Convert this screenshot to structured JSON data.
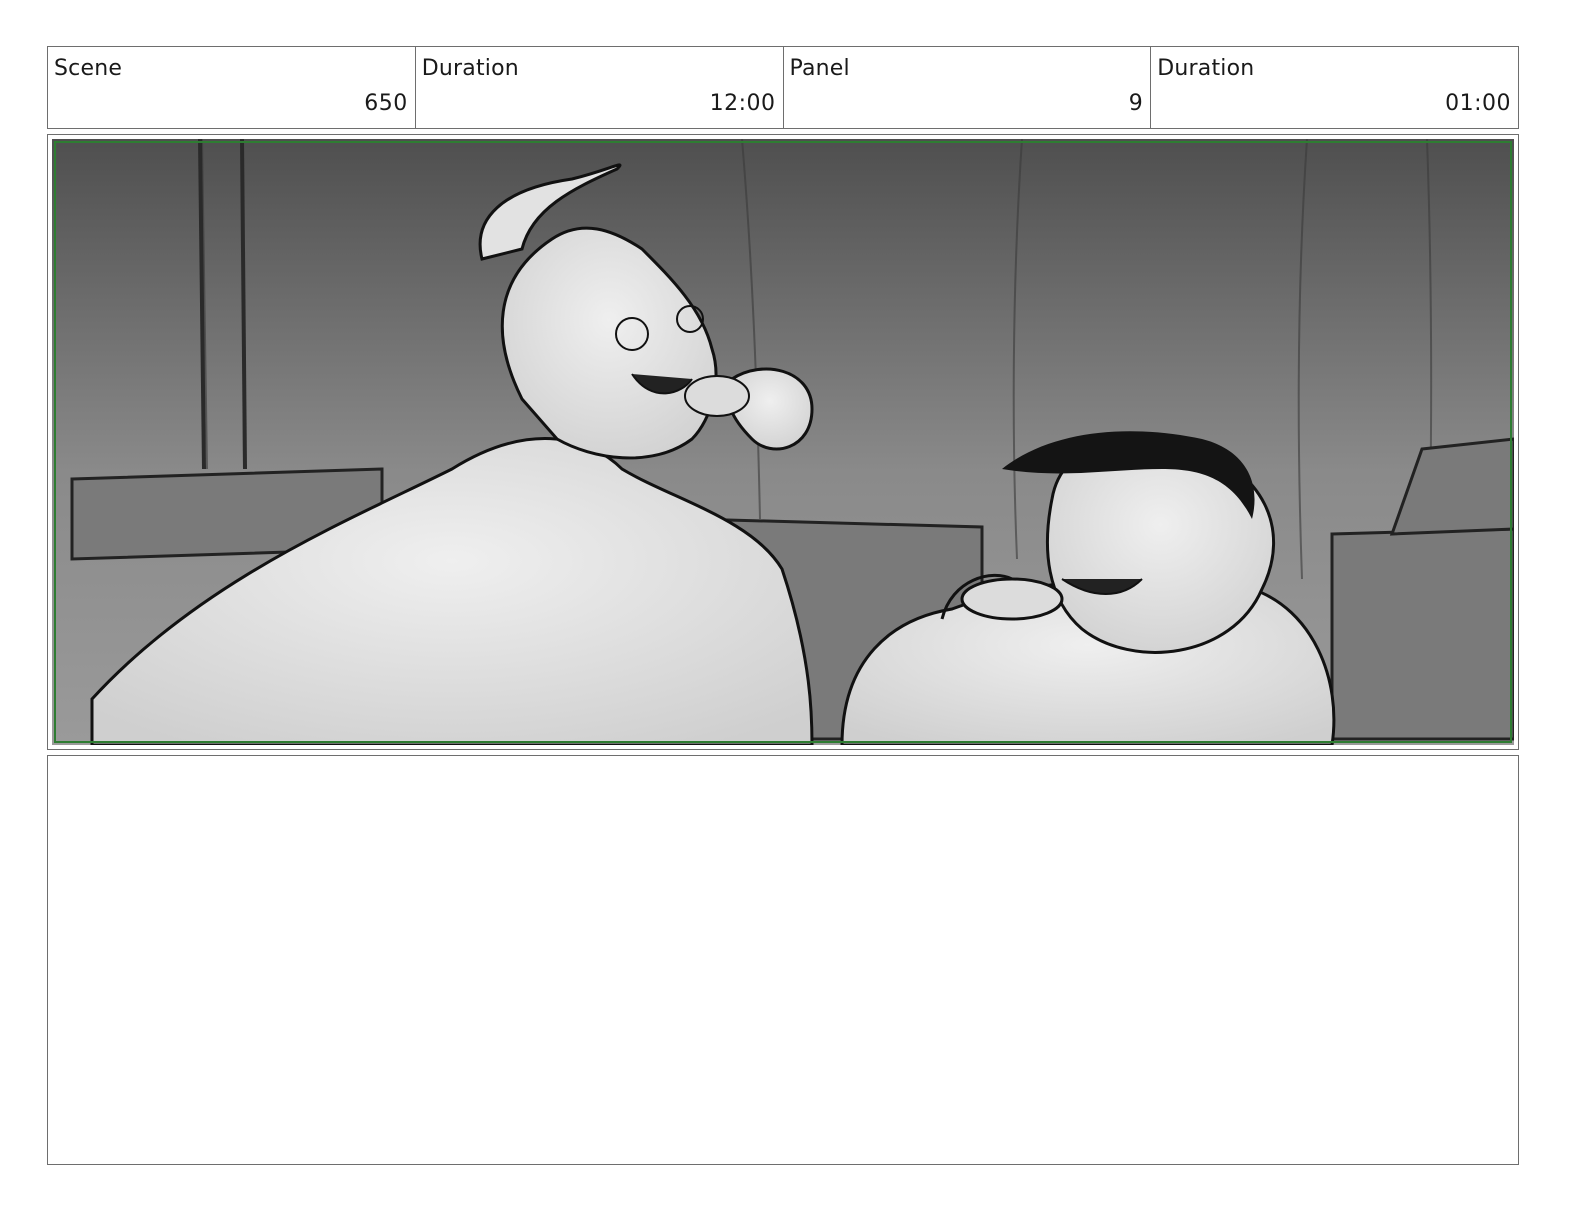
{
  "header": {
    "scene_label": "Scene",
    "scene_value": "650",
    "scene_duration_label": "Duration",
    "scene_duration_value": "12:00",
    "panel_label": "Panel",
    "panel_value": "9",
    "panel_duration_label": "Duration",
    "panel_duration_value": "01:00"
  },
  "colors": {
    "border": "#6e6e6e",
    "safe_frame": "#2e7d32",
    "sketch_line": "#111111"
  }
}
